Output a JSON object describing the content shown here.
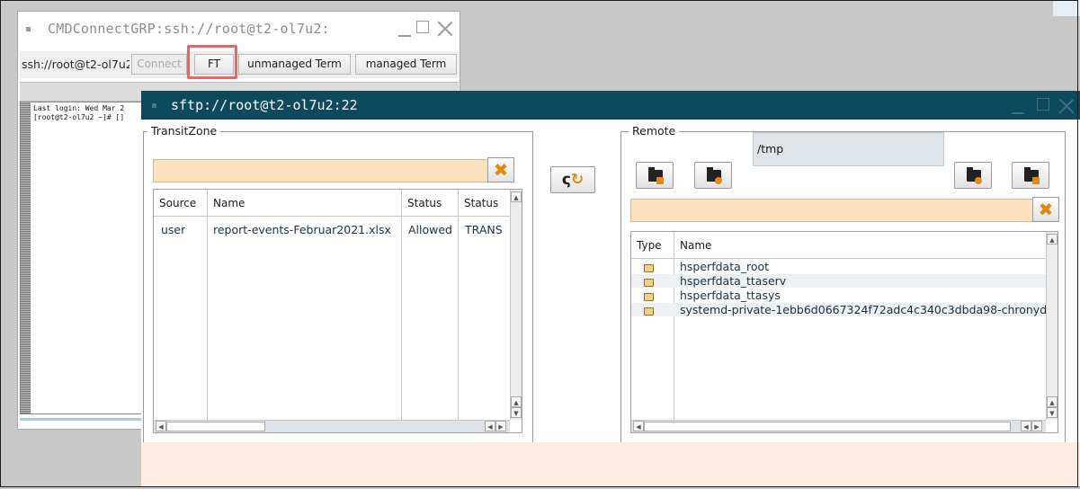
{
  "background_window": {
    "title": "CMDConnectGRP:ssh://root@t2-ol7u2:",
    "address_text": "ssh://root@t2-ol7u2",
    "buttons": {
      "connect": "Connect",
      "ft": "FT",
      "unmanaged_term": "unmanaged Term",
      "managed_term": "managed Term"
    },
    "terminal_lines": [
      "Last login: Wed Mar 2",
      "[root@t2-ol7u2 ~]# []"
    ]
  },
  "sftp_window": {
    "title": "sftp://root@t2-ol7u2:22",
    "transit": {
      "label": "TransitZone",
      "filter_value": "",
      "columns": [
        "Source",
        "Name",
        "Status",
        "Status"
      ],
      "rows": [
        {
          "source": "user",
          "name": "report-events-Februar2021.xlsx",
          "status": "Allowed",
          "status2": "TRANS"
        }
      ]
    },
    "remote": {
      "label": "Remote",
      "path": "/tmp",
      "filter_value": "",
      "columns": [
        "Type",
        "Name"
      ],
      "rows": [
        {
          "type": "folder-icon",
          "name": "hsperfdata_root"
        },
        {
          "type": "folder-icon",
          "name": "hsperfdata_ttaserv"
        },
        {
          "type": "folder-icon",
          "name": "hsperfdata_ttasys"
        },
        {
          "type": "folder-icon",
          "name": "systemd-private-1ebb6d0667324f72adc4c340c3dbda98-chronyd."
        }
      ]
    },
    "icons": {
      "clear": "clear-x-icon",
      "swap": "swap-refresh-icon",
      "new_folder": "new-folder-icon",
      "upload": "folder-up-icon",
      "refresh": "folder-refresh-icon",
      "delete": "folder-delete-icon"
    }
  },
  "colors": {
    "title_bar": "#0e4a5e",
    "filter_bg": "#fde0c0",
    "accent_orange": "#e08a10",
    "highlight": "#e06a6a"
  }
}
